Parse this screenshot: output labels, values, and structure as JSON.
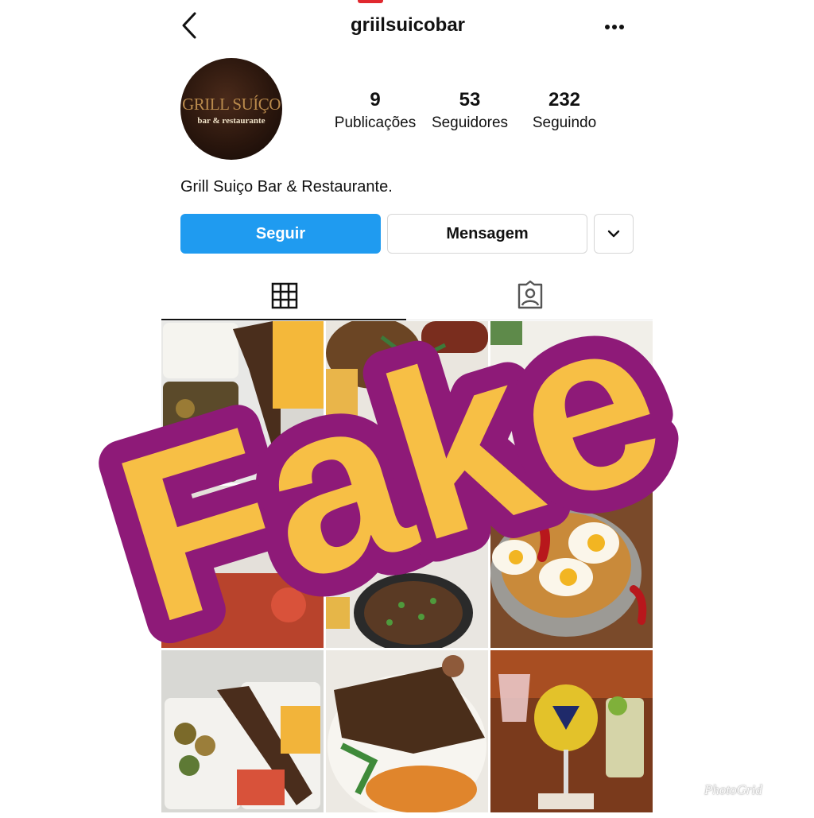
{
  "profile": {
    "username": "griilsuicobar",
    "avatar_logo_main": "GRILL SUÍÇO",
    "avatar_logo_sub": "bar & restaurante",
    "bio": "Grill Suiço Bar & Restaurante."
  },
  "stats": [
    {
      "count": "9",
      "label": "Publicações"
    },
    {
      "count": "53",
      "label": "Seguidores"
    },
    {
      "count": "232",
      "label": "Seguindo"
    }
  ],
  "actions": {
    "follow_label": "Seguir",
    "message_label": "Mensagem",
    "more_icon": "chevron-down-icon"
  },
  "header_icons": {
    "back": "chevron-left-icon",
    "more": "more-horizontal-icon"
  },
  "tabs": [
    {
      "icon": "grid-icon",
      "active": true
    },
    {
      "icon": "tagged-icon",
      "active": false
    }
  ],
  "overlay": {
    "stamp_text": "Fake",
    "watermark": "PhotoGrid"
  },
  "colors": {
    "follow_button": "#1f9bf0",
    "stamp_fill": "#f7bf45",
    "stamp_outline": "#8e1a78"
  },
  "posts": [
    {
      "name": "post-1",
      "icon": "grilled-meat-lunchbox-photo"
    },
    {
      "name": "post-2",
      "icon": "beans-and-sausage-photo"
    },
    {
      "name": "post-3",
      "icon": "plate-photo"
    },
    {
      "name": "post-4",
      "icon": "tomato-dish-photo"
    },
    {
      "name": "post-5",
      "icon": "bean-stew-photo"
    },
    {
      "name": "post-6",
      "icon": "eggs-and-sausage-pan-photo"
    },
    {
      "name": "post-7",
      "icon": "skewer-lunchbox-photo"
    },
    {
      "name": "post-8",
      "icon": "steak-and-spaghetti-photo"
    },
    {
      "name": "post-9",
      "icon": "cocktails-photo"
    }
  ]
}
